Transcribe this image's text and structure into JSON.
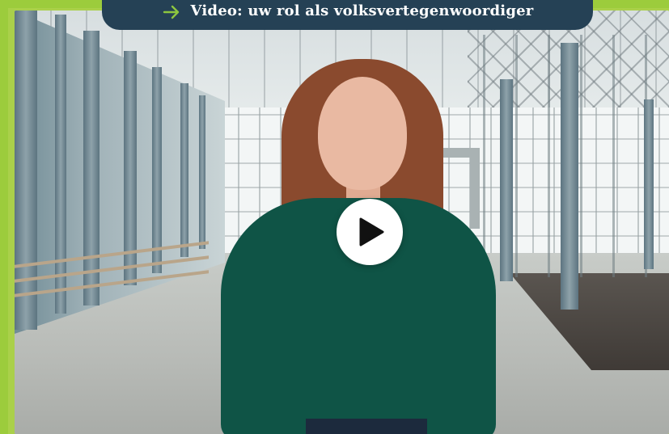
{
  "video": {
    "title": "Video: uw rol als volksvertegenwoordiger",
    "play_icon": "play-icon",
    "arrow_icon": "arrow-right-icon"
  },
  "colors": {
    "border": "#9ccc3c",
    "tab_bg": "#254155",
    "arrow": "#8dc63f",
    "play_bg": "#ffffff",
    "play_triangle": "#111111"
  }
}
